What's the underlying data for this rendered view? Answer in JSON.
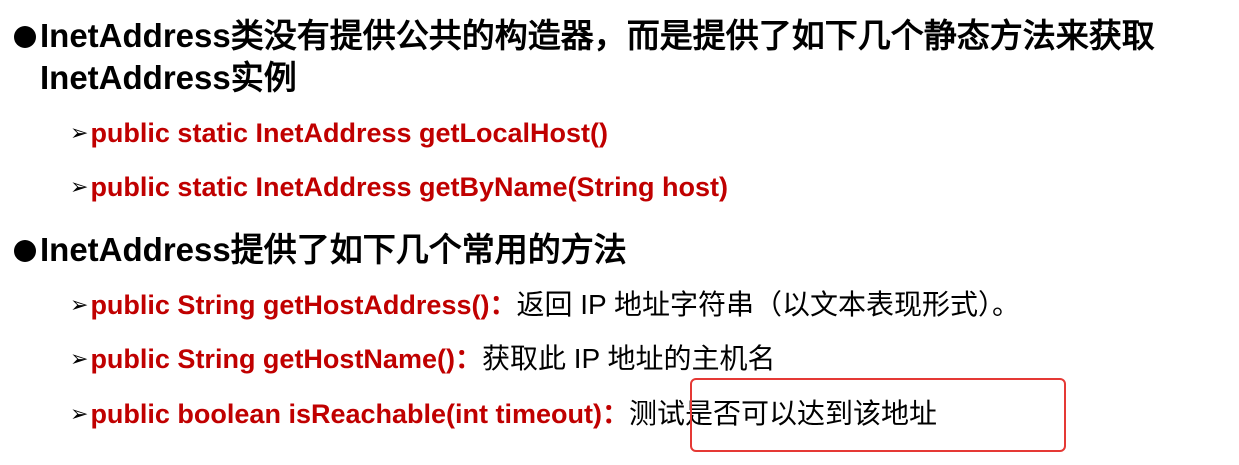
{
  "bullet1": {
    "en": "InetAddress",
    "cn": "类没有提供公共的构造器，而是提供了如下几个静态方法来获取",
    "line2_en": "InetAddress",
    "line2_cn": "实例"
  },
  "methods1": [
    {
      "sig": "public static InetAddress getLocalHost()"
    },
    {
      "sig": "public static InetAddress getByName(String host)"
    }
  ],
  "bullet2": {
    "en": "InetAddress",
    "cn": "提供了如下几个常用的方法"
  },
  "methods2": [
    {
      "sig": "public String getHostAddress()：",
      "desc": "返回 IP 地址字符串（以文本表现形式）。"
    },
    {
      "sig": "public String getHostName()：",
      "desc": "获取此 IP 地址的主机名"
    },
    {
      "sig": "public boolean isReachable(int timeout)：",
      "desc": "测试是否可以达到该地址"
    }
  ],
  "colors": {
    "signature": "#c00000",
    "highlight_border": "#e53935",
    "text": "#000000"
  },
  "icons": {
    "bullet": "filled-circle",
    "sub_bullet": "right-arrowhead"
  }
}
